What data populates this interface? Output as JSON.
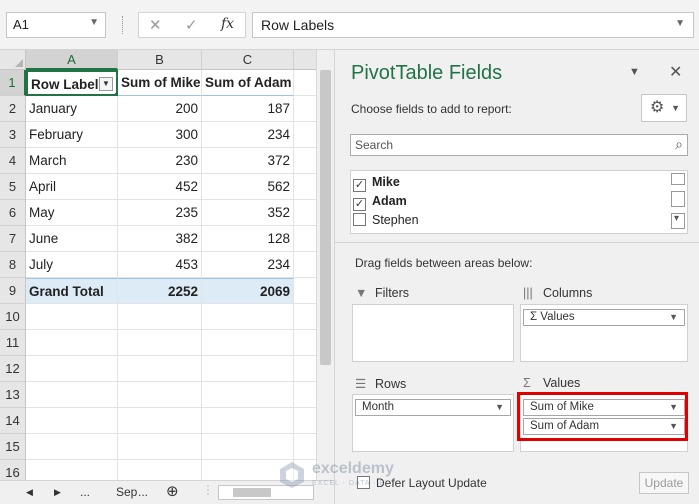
{
  "formula_bar": {
    "name_box": "A1",
    "cancel_glyph": "✕",
    "enter_glyph": "✓",
    "fx_label": "fx",
    "content": "Row Labels"
  },
  "grid": {
    "columns": [
      "A",
      "B",
      "C"
    ],
    "rows": [
      "1",
      "2",
      "3",
      "4",
      "5",
      "6",
      "7",
      "8",
      "9",
      "10",
      "11",
      "12",
      "13",
      "14",
      "15",
      "16"
    ],
    "header": [
      "Row Labels",
      "Sum of Mike",
      "Sum of Adam"
    ],
    "data": [
      [
        "January",
        "200",
        "187"
      ],
      [
        "February",
        "300",
        "234"
      ],
      [
        "March",
        "230",
        "372"
      ],
      [
        "April",
        "452",
        "562"
      ],
      [
        "May",
        "235",
        "352"
      ],
      [
        "June",
        "382",
        "128"
      ],
      [
        "July",
        "453",
        "234"
      ]
    ],
    "total": [
      "Grand Total",
      "2252",
      "2069"
    ]
  },
  "sheet_tabs": {
    "prev": "◀",
    "next": "▶",
    "more_left": "...",
    "sheet_name": "Sep",
    "more_right": "...",
    "add": "⊕"
  },
  "pivot_pane": {
    "title": "PivotTable Fields",
    "choose_label": "Choose fields to add to report:",
    "search_placeholder": "Search",
    "fields": [
      {
        "label": "Mike",
        "checked": true
      },
      {
        "label": "Adam",
        "checked": true
      },
      {
        "label": "Stephen",
        "checked": false
      }
    ],
    "drag_label": "Drag fields between areas below:",
    "filters_label": "Filters",
    "columns_label": "Columns",
    "rows_label": "Rows",
    "values_label": "Values",
    "columns_items": [
      "Σ Values"
    ],
    "rows_items": [
      "Month"
    ],
    "values_items": [
      "Sum of Mike",
      "Sum of Adam"
    ],
    "defer_label": "Defer Layout Update",
    "update_label": "Update"
  },
  "watermark": {
    "brand": "exceldemy",
    "tagline": "EXCEL · DATA · BI"
  },
  "colors": {
    "excel_green": "#217346",
    "highlight_red": "#e00000",
    "total_row_fill": "#ddebf7"
  }
}
